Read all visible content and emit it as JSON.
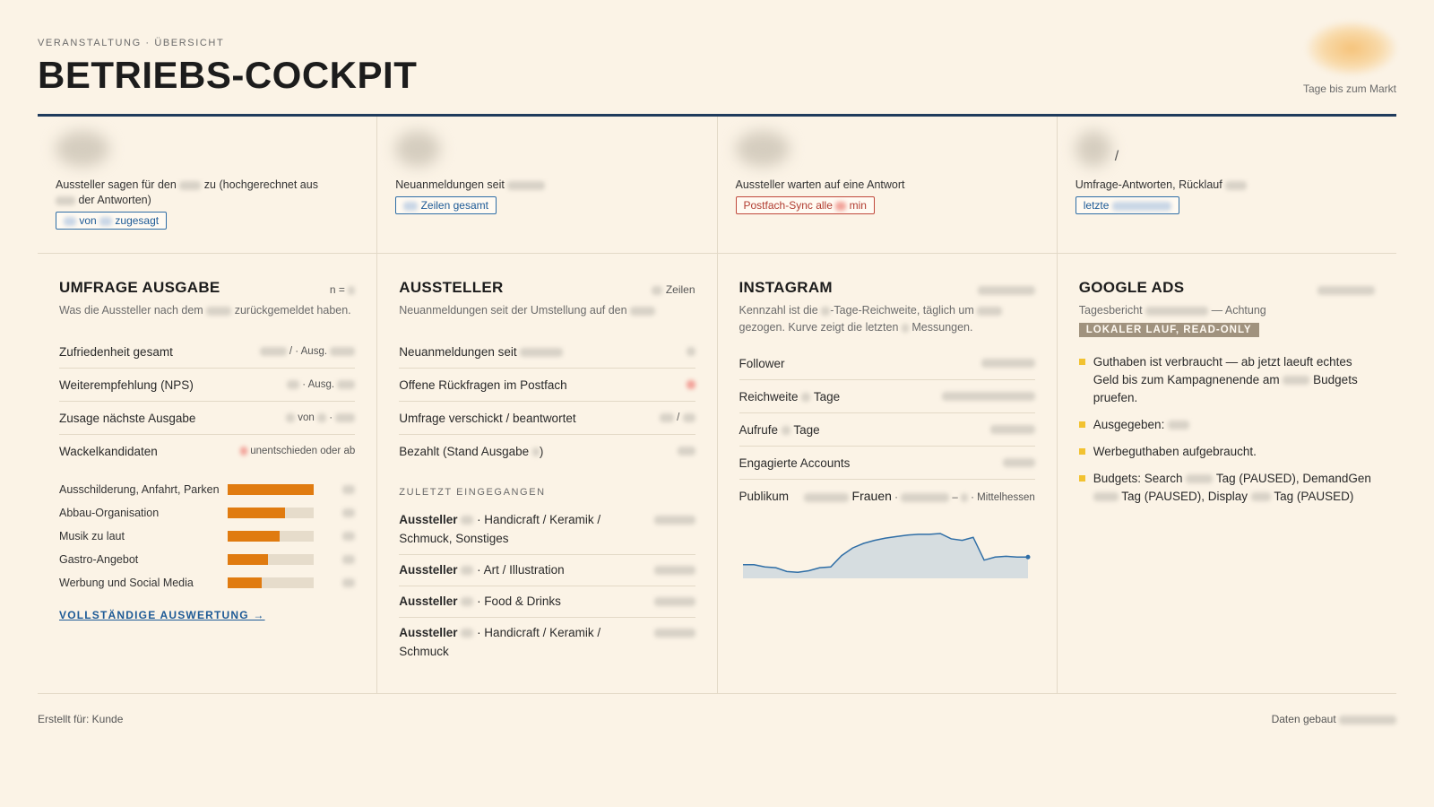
{
  "header": {
    "eyebrow": "VERANSTALTUNG · ÜBERSICHT",
    "title": "BETRIEBS-COCKPIT",
    "countdown_label": "Tage bis zum Markt"
  },
  "kpis": [
    {
      "label_a": "Aussteller sagen für den",
      "label_b": "zu (hochgerechnet aus",
      "label_c": "der Antworten)",
      "chip_a": "von",
      "chip_b": "zugesagt"
    },
    {
      "label_a": "Neuanmeldungen seit",
      "chip": "Zeilen gesamt"
    },
    {
      "label_a": "Aussteller warten auf eine Antwort",
      "chip_a": "Postfach-Sync alle",
      "chip_b": "min"
    },
    {
      "slash": "/",
      "label_a": "Umfrage-Antworten, Rücklauf",
      "chip": "letzte"
    }
  ],
  "survey": {
    "title": "UMFRAGE AUSGABE",
    "aside": "n =",
    "desc_a": "Was die Aussteller nach dem",
    "desc_b": "zurückgemeldet haben.",
    "rows": [
      {
        "label": "Zufriedenheit gesamt",
        "val_a": "/",
        "val_b": "· Ausg."
      },
      {
        "label": "Weiterempfehlung (NPS)",
        "val_a": "· Ausg."
      },
      {
        "label": "Zusage nächste Ausgabe",
        "val_a": "von",
        "val_b": "·"
      },
      {
        "label": "Wackelkandidaten",
        "val_a": "unentschieden oder ab"
      }
    ],
    "bars": [
      {
        "label": "Ausschilderung, Anfahrt, Parken",
        "value": 1.0
      },
      {
        "label": "Abbau-Organisation",
        "value": 0.67
      },
      {
        "label": "Musik zu laut",
        "value": 0.6
      },
      {
        "label": "Gastro-Angebot",
        "value": 0.47
      },
      {
        "label": "Werbung und Social Media",
        "value": 0.4
      }
    ],
    "link": "VOLLSTÄNDIGE AUSWERTUNG →"
  },
  "exhibitors": {
    "title": "AUSSTELLER",
    "aside": "Zeilen",
    "desc": "Neuanmeldungen seit der Umstellung auf den",
    "rows": [
      {
        "label": "Neuanmeldungen seit"
      },
      {
        "label": "Offene Rückfragen im Postfach"
      },
      {
        "label": "Umfrage verschickt / beantwortet",
        "val": "/"
      },
      {
        "label": "Bezahlt (Stand Ausgabe",
        "suffix": ")"
      }
    ],
    "recent_title": "ZULETZT EINGEGANGEN",
    "recent": [
      {
        "name": "Aussteller",
        "cat": "· Handicraft / Keramik / Schmuck, Sonstiges"
      },
      {
        "name": "Aussteller",
        "cat": "· Art / Illustration"
      },
      {
        "name": "Aussteller",
        "cat": "· Food & Drinks"
      },
      {
        "name": "Aussteller",
        "cat": "· Handicraft / Keramik / Schmuck"
      }
    ]
  },
  "instagram": {
    "title": "INSTAGRAM",
    "desc_a": "Kennzahl ist die",
    "desc_b": "-Tage-Reichweite, täglich um",
    "desc_c": "gezogen. Kurve zeigt die letzten",
    "desc_d": "Messungen.",
    "rows": [
      {
        "label": "Follower"
      },
      {
        "label_a": "Reichweite",
        "label_b": "Tage"
      },
      {
        "label_a": "Aufrufe",
        "label_b": "Tage"
      },
      {
        "label": "Engagierte Accounts"
      },
      {
        "label": "Publikum",
        "mid": "Frauen",
        "dot": "·",
        "dash": "–",
        "tail": "· Mittelhessen"
      }
    ],
    "spark": [
      18,
      18,
      15,
      14,
      9,
      8,
      10,
      14,
      15,
      30,
      40,
      46,
      50,
      53,
      55,
      57,
      58,
      58,
      59,
      52,
      50,
      54,
      24,
      28,
      29,
      28,
      28
    ]
  },
  "google_ads": {
    "title": "GOOGLE ADS",
    "sub_a": "Tagesbericht",
    "sub_b": "— Achtung",
    "badge": "LOKALER LAUF, READ-ONLY",
    "bullets": [
      {
        "a": "Guthaben ist verbraucht — ab jetzt laeuft echtes Geld bis zum Kampagnenende am",
        "b": "Budgets pruefen."
      },
      {
        "a": "Ausgegeben:"
      },
      {
        "a": "Werbeguthaben aufgebraucht."
      },
      {
        "a": "Budgets: Search",
        "b": "Tag (PAUSED), DemandGen",
        "c": "Tag (PAUSED), Display",
        "d": "Tag (PAUSED)"
      }
    ]
  },
  "footer": {
    "left": "Erstellt für: Kunde",
    "right": "Daten gebaut"
  },
  "colors": {
    "accent": "#e07b10",
    "rule": "#1f3b5c",
    "link": "#1d5a96",
    "badge": "#a0927e",
    "bullet": "#f2c230",
    "spark_line": "#2f6ea6",
    "spark_fill": "#d6dde0"
  }
}
